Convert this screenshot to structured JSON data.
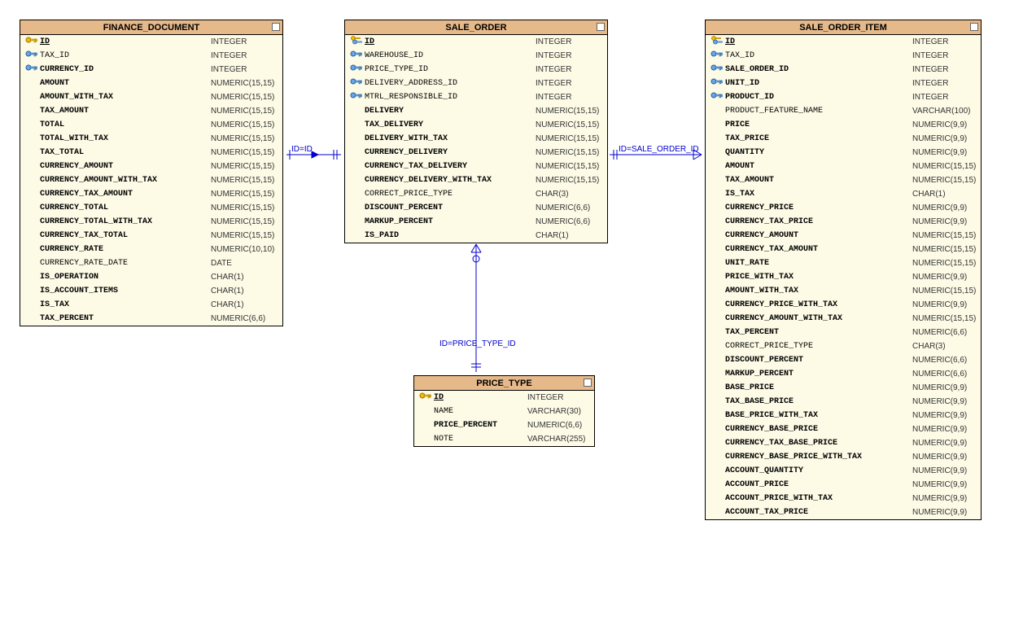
{
  "entities": {
    "finance_document": {
      "title": "FINANCE_DOCUMENT",
      "columns": [
        {
          "icon": "pk",
          "name": "ID",
          "type": "INTEGER",
          "bold": true,
          "pk": true
        },
        {
          "icon": "fk",
          "name": "TAX_ID",
          "type": "INTEGER",
          "bold": false,
          "pk": false
        },
        {
          "icon": "fk",
          "name": "CURRENCY_ID",
          "type": "INTEGER",
          "bold": true,
          "pk": false
        },
        {
          "icon": "",
          "name": "AMOUNT",
          "type": "NUMERIC(15,15)",
          "bold": true,
          "pk": false
        },
        {
          "icon": "",
          "name": "AMOUNT_WITH_TAX",
          "type": "NUMERIC(15,15)",
          "bold": true,
          "pk": false
        },
        {
          "icon": "",
          "name": "TAX_AMOUNT",
          "type": "NUMERIC(15,15)",
          "bold": true,
          "pk": false
        },
        {
          "icon": "",
          "name": "TOTAL",
          "type": "NUMERIC(15,15)",
          "bold": true,
          "pk": false
        },
        {
          "icon": "",
          "name": "TOTAL_WITH_TAX",
          "type": "NUMERIC(15,15)",
          "bold": true,
          "pk": false
        },
        {
          "icon": "",
          "name": "TAX_TOTAL",
          "type": "NUMERIC(15,15)",
          "bold": true,
          "pk": false
        },
        {
          "icon": "",
          "name": "CURRENCY_AMOUNT",
          "type": "NUMERIC(15,15)",
          "bold": true,
          "pk": false
        },
        {
          "icon": "",
          "name": "CURRENCY_AMOUNT_WITH_TAX",
          "type": "NUMERIC(15,15)",
          "bold": true,
          "pk": false
        },
        {
          "icon": "",
          "name": "CURRENCY_TAX_AMOUNT",
          "type": "NUMERIC(15,15)",
          "bold": true,
          "pk": false
        },
        {
          "icon": "",
          "name": "CURRENCY_TOTAL",
          "type": "NUMERIC(15,15)",
          "bold": true,
          "pk": false
        },
        {
          "icon": "",
          "name": "CURRENCY_TOTAL_WITH_TAX",
          "type": "NUMERIC(15,15)",
          "bold": true,
          "pk": false
        },
        {
          "icon": "",
          "name": "CURRENCY_TAX_TOTAL",
          "type": "NUMERIC(15,15)",
          "bold": true,
          "pk": false
        },
        {
          "icon": "",
          "name": "CURRENCY_RATE",
          "type": "NUMERIC(10,10)",
          "bold": true,
          "pk": false
        },
        {
          "icon": "",
          "name": "CURRENCY_RATE_DATE",
          "type": "DATE",
          "bold": false,
          "pk": false
        },
        {
          "icon": "",
          "name": "IS_OPERATION",
          "type": "CHAR(1)",
          "bold": true,
          "pk": false
        },
        {
          "icon": "",
          "name": "IS_ACCOUNT_ITEMS",
          "type": "CHAR(1)",
          "bold": true,
          "pk": false
        },
        {
          "icon": "",
          "name": "IS_TAX",
          "type": "CHAR(1)",
          "bold": true,
          "pk": false
        },
        {
          "icon": "",
          "name": "TAX_PERCENT",
          "type": "NUMERIC(6,6)",
          "bold": true,
          "pk": false
        }
      ]
    },
    "sale_order": {
      "title": "SALE_ORDER",
      "columns": [
        {
          "icon": "fkpk",
          "name": "ID",
          "type": "INTEGER",
          "bold": true,
          "pk": true
        },
        {
          "icon": "fk",
          "name": "WAREHOUSE_ID",
          "type": "INTEGER",
          "bold": false,
          "pk": false
        },
        {
          "icon": "fk",
          "name": "PRICE_TYPE_ID",
          "type": "INTEGER",
          "bold": false,
          "pk": false
        },
        {
          "icon": "fk",
          "name": "DELIVERY_ADDRESS_ID",
          "type": "INTEGER",
          "bold": false,
          "pk": false
        },
        {
          "icon": "fk",
          "name": "MTRL_RESPONSIBLE_ID",
          "type": "INTEGER",
          "bold": false,
          "pk": false
        },
        {
          "icon": "",
          "name": "DELIVERY",
          "type": "NUMERIC(15,15)",
          "bold": true,
          "pk": false
        },
        {
          "icon": "",
          "name": "TAX_DELIVERY",
          "type": "NUMERIC(15,15)",
          "bold": true,
          "pk": false
        },
        {
          "icon": "",
          "name": "DELIVERY_WITH_TAX",
          "type": "NUMERIC(15,15)",
          "bold": true,
          "pk": false
        },
        {
          "icon": "",
          "name": "CURRENCY_DELIVERY",
          "type": "NUMERIC(15,15)",
          "bold": true,
          "pk": false
        },
        {
          "icon": "",
          "name": "CURRENCY_TAX_DELIVERY",
          "type": "NUMERIC(15,15)",
          "bold": true,
          "pk": false
        },
        {
          "icon": "",
          "name": "CURRENCY_DELIVERY_WITH_TAX",
          "type": "NUMERIC(15,15)",
          "bold": true,
          "pk": false
        },
        {
          "icon": "",
          "name": "CORRECT_PRICE_TYPE",
          "type": "CHAR(3)",
          "bold": false,
          "pk": false
        },
        {
          "icon": "",
          "name": "DISCOUNT_PERCENT",
          "type": "NUMERIC(6,6)",
          "bold": true,
          "pk": false
        },
        {
          "icon": "",
          "name": "MARKUP_PERCENT",
          "type": "NUMERIC(6,6)",
          "bold": true,
          "pk": false
        },
        {
          "icon": "",
          "name": "IS_PAID",
          "type": "CHAR(1)",
          "bold": true,
          "pk": false
        }
      ]
    },
    "sale_order_item": {
      "title": "SALE_ORDER_ITEM",
      "columns": [
        {
          "icon": "fkpk",
          "name": "ID",
          "type": "INTEGER",
          "bold": true,
          "pk": true
        },
        {
          "icon": "fk",
          "name": "TAX_ID",
          "type": "INTEGER",
          "bold": false,
          "pk": false
        },
        {
          "icon": "fk",
          "name": "SALE_ORDER_ID",
          "type": "INTEGER",
          "bold": true,
          "pk": false
        },
        {
          "icon": "fk",
          "name": "UNIT_ID",
          "type": "INTEGER",
          "bold": true,
          "pk": false
        },
        {
          "icon": "fk",
          "name": "PRODUCT_ID",
          "type": "INTEGER",
          "bold": true,
          "pk": false
        },
        {
          "icon": "",
          "name": "PRODUCT_FEATURE_NAME",
          "type": "VARCHAR(100)",
          "bold": false,
          "pk": false
        },
        {
          "icon": "",
          "name": "PRICE",
          "type": "NUMERIC(9,9)",
          "bold": true,
          "pk": false
        },
        {
          "icon": "",
          "name": "TAX_PRICE",
          "type": "NUMERIC(9,9)",
          "bold": true,
          "pk": false
        },
        {
          "icon": "",
          "name": "QUANTITY",
          "type": "NUMERIC(9,9)",
          "bold": true,
          "pk": false
        },
        {
          "icon": "",
          "name": "AMOUNT",
          "type": "NUMERIC(15,15)",
          "bold": true,
          "pk": false
        },
        {
          "icon": "",
          "name": "TAX_AMOUNT",
          "type": "NUMERIC(15,15)",
          "bold": true,
          "pk": false
        },
        {
          "icon": "",
          "name": "IS_TAX",
          "type": "CHAR(1)",
          "bold": true,
          "pk": false
        },
        {
          "icon": "",
          "name": "CURRENCY_PRICE",
          "type": "NUMERIC(9,9)",
          "bold": true,
          "pk": false
        },
        {
          "icon": "",
          "name": "CURRENCY_TAX_PRICE",
          "type": "NUMERIC(9,9)",
          "bold": true,
          "pk": false
        },
        {
          "icon": "",
          "name": "CURRENCY_AMOUNT",
          "type": "NUMERIC(15,15)",
          "bold": true,
          "pk": false
        },
        {
          "icon": "",
          "name": "CURRENCY_TAX_AMOUNT",
          "type": "NUMERIC(15,15)",
          "bold": true,
          "pk": false
        },
        {
          "icon": "",
          "name": "UNIT_RATE",
          "type": "NUMERIC(15,15)",
          "bold": true,
          "pk": false
        },
        {
          "icon": "",
          "name": "PRICE_WITH_TAX",
          "type": "NUMERIC(9,9)",
          "bold": true,
          "pk": false
        },
        {
          "icon": "",
          "name": "AMOUNT_WITH_TAX",
          "type": "NUMERIC(15,15)",
          "bold": true,
          "pk": false
        },
        {
          "icon": "",
          "name": "CURRENCY_PRICE_WITH_TAX",
          "type": "NUMERIC(9,9)",
          "bold": true,
          "pk": false
        },
        {
          "icon": "",
          "name": "CURRENCY_AMOUNT_WITH_TAX",
          "type": "NUMERIC(15,15)",
          "bold": true,
          "pk": false
        },
        {
          "icon": "",
          "name": "TAX_PERCENT",
          "type": "NUMERIC(6,6)",
          "bold": true,
          "pk": false
        },
        {
          "icon": "",
          "name": "CORRECT_PRICE_TYPE",
          "type": "CHAR(3)",
          "bold": false,
          "pk": false
        },
        {
          "icon": "",
          "name": "DISCOUNT_PERCENT",
          "type": "NUMERIC(6,6)",
          "bold": true,
          "pk": false
        },
        {
          "icon": "",
          "name": "MARKUP_PERCENT",
          "type": "NUMERIC(6,6)",
          "bold": true,
          "pk": false
        },
        {
          "icon": "",
          "name": "BASE_PRICE",
          "type": "NUMERIC(9,9)",
          "bold": true,
          "pk": false
        },
        {
          "icon": "",
          "name": "TAX_BASE_PRICE",
          "type": "NUMERIC(9,9)",
          "bold": true,
          "pk": false
        },
        {
          "icon": "",
          "name": "BASE_PRICE_WITH_TAX",
          "type": "NUMERIC(9,9)",
          "bold": true,
          "pk": false
        },
        {
          "icon": "",
          "name": "CURRENCY_BASE_PRICE",
          "type": "NUMERIC(9,9)",
          "bold": true,
          "pk": false
        },
        {
          "icon": "",
          "name": "CURRENCY_TAX_BASE_PRICE",
          "type": "NUMERIC(9,9)",
          "bold": true,
          "pk": false
        },
        {
          "icon": "",
          "name": "CURRENCY_BASE_PRICE_WITH_TAX",
          "type": "NUMERIC(9,9)",
          "bold": true,
          "pk": false
        },
        {
          "icon": "",
          "name": "ACCOUNT_QUANTITY",
          "type": "NUMERIC(9,9)",
          "bold": true,
          "pk": false
        },
        {
          "icon": "",
          "name": "ACCOUNT_PRICE",
          "type": "NUMERIC(9,9)",
          "bold": true,
          "pk": false
        },
        {
          "icon": "",
          "name": "ACCOUNT_PRICE_WITH_TAX",
          "type": "NUMERIC(9,9)",
          "bold": true,
          "pk": false
        },
        {
          "icon": "",
          "name": "ACCOUNT_TAX_PRICE",
          "type": "NUMERIC(9,9)",
          "bold": true,
          "pk": false
        }
      ]
    },
    "price_type": {
      "title": "PRICE_TYPE",
      "columns": [
        {
          "icon": "pk",
          "name": "ID",
          "type": "INTEGER",
          "bold": true,
          "pk": true
        },
        {
          "icon": "",
          "name": "NAME",
          "type": "VARCHAR(30)",
          "bold": false,
          "pk": false
        },
        {
          "icon": "",
          "name": "PRICE_PERCENT",
          "type": "NUMERIC(6,6)",
          "bold": true,
          "pk": false
        },
        {
          "icon": "",
          "name": "NOTE",
          "type": "VARCHAR(255)",
          "bold": false,
          "pk": false
        }
      ]
    }
  },
  "relationships": {
    "r1": {
      "label": "ID=ID"
    },
    "r2": {
      "label": "ID=SALE_ORDER_ID"
    },
    "r3": {
      "label": "ID=PRICE_TYPE_ID"
    }
  }
}
